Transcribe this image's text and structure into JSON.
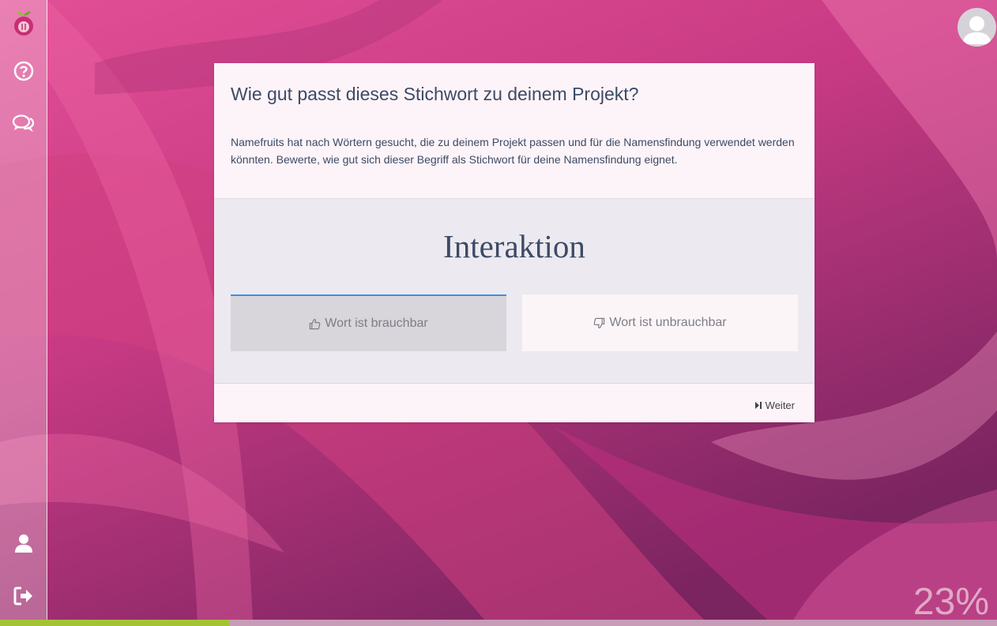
{
  "sidebar": {
    "items": [
      {
        "icon": "logo-fruit-icon"
      },
      {
        "icon": "help-icon"
      },
      {
        "icon": "chat-icon"
      },
      {
        "icon": "user-icon"
      },
      {
        "icon": "logout-icon"
      }
    ]
  },
  "card": {
    "title": "Wie gut passt dieses Stichwort zu deinem Projekt?",
    "description": "Namefruits hat nach Wörtern gesucht, die zu deinem Projekt passen und für die Namensfindung verwendet werden könnten. Bewerte, wie gut sich dieser Begriff als Stichwort für deine Namensfindung eignet.",
    "keyword": "Interaktion",
    "buttons": {
      "useful_label": "Wort ist brauchbar",
      "useless_label": "Wort ist unbrauchbar"
    },
    "next_label": "Weiter"
  },
  "progress": {
    "percent_label": "23%",
    "fraction": 0.23
  },
  "colors": {
    "accent": "#3e8fe0",
    "progress": "#a4c334",
    "text": "#3d4a66"
  }
}
